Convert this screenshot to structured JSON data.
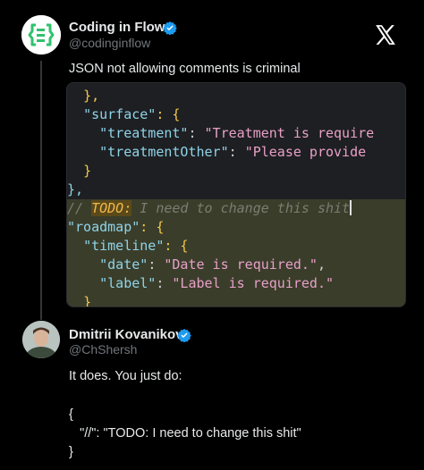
{
  "post": {
    "author_name": "Coding in Flow",
    "author_handle": "@codinginflow",
    "text": "JSON not allowing comments is criminal",
    "logo_icon": "coding-in-flow-logo",
    "verified_color": "#1d9bf0",
    "code_lines": [
      [
        "  ",
        "},",
        ""
      ],
      [
        "  ",
        "\"surface\"",
        ": {"
      ],
      [
        "    ",
        "\"treatment\"",
        ": ",
        "\"Treatment is require"
      ],
      [
        "    ",
        "\"treatmentOther\"",
        ": ",
        "\"Please provide"
      ],
      [
        "  ",
        "}",
        ""
      ],
      [
        "",
        "},",
        ""
      ],
      [
        "",
        "// ",
        "TODO:",
        " I need to change this shit"
      ],
      [
        "",
        "\"roadmap\"",
        ": {"
      ],
      [
        "  ",
        "\"timeline\"",
        ": {"
      ],
      [
        "    ",
        "\"date\"",
        ": ",
        "\"Date is required.\"",
        ","
      ],
      [
        "    ",
        "\"label\"",
        ": ",
        "\"Label is required.\""
      ],
      [
        "  ",
        "}"
      ]
    ]
  },
  "reply": {
    "author_name": "Dmitrii Kovanikov",
    "author_handle": "@ChShersh",
    "text_line1": "It does. You just do:",
    "code_line1": "{",
    "code_line2": "   \"//\": \"TODO: I need to change this shit\"",
    "code_line3": "}"
  },
  "platform_icon": "x-logo-icon"
}
